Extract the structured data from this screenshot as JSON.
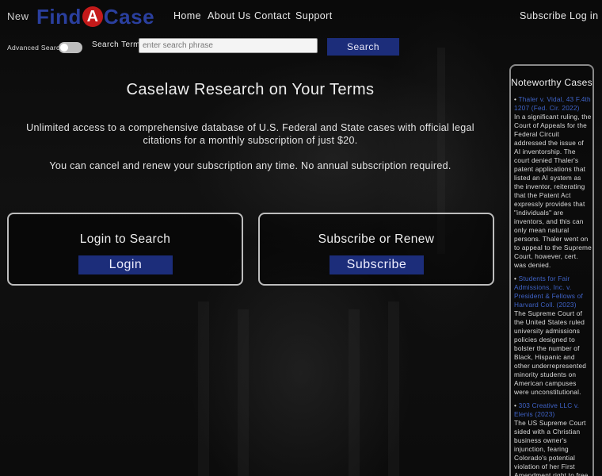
{
  "header": {
    "new_label": "New",
    "logo": {
      "left": "Find",
      "badge": "A",
      "right": "Case"
    },
    "nav": {
      "home": "Home",
      "about": "About Us",
      "contact": "Contact",
      "support": "Support",
      "subscribe": "Subscribe",
      "login": "Log in"
    }
  },
  "search": {
    "advanced_label": "Advanced Search:",
    "term_label": "Search Term:",
    "placeholder": "enter search phrase",
    "button": "Search"
  },
  "hero": {
    "title": "Caselaw Research on Your Terms",
    "text1": "Unlimited access to a comprehensive database of U.S. Federal and State cases with official legal citations for a monthly subscription of just $20.",
    "text2": "You can cancel and renew your subscription any time. No annual subscription required."
  },
  "cards": {
    "login": {
      "title": "Login to Search",
      "button": "Login"
    },
    "subscribe": {
      "title": "Subscribe or Renew",
      "button": "Subscribe"
    }
  },
  "sidebar": {
    "title": "Noteworthy Cases",
    "cases": [
      {
        "link": "Thaler v. Vidal, 43 F.4th 1207 (Fed. Cir. 2022)",
        "text": "In a significant ruling, the Court of Appeals for the Federal Circuit addressed the issue of AI inventorship. The court denied Thaler's patent applications that listed an AI system as the inventor, reiterating that the Patent Act expressly provides that \"individuals\" are inventors, and this can only mean natural persons. Thaler went on to appeal to the Supreme Court, however, cert. was denied."
      },
      {
        "link": "Students for Fair Admissions, Inc. v. President & Fellows of Harvard Coll. (2023)",
        "text": "The Supreme Court of the United States ruled university admissions policies designed to bolster the number of Black, Hispanic and other underrepresented minority students on American campuses were unconstitutional."
      },
      {
        "link": "303 Creative LLC v. Elenis (2023)",
        "text": "The US Supreme Court sided with a Christian business owner's injunction, fearing Colorado's potential violation of her First Amendment right to free"
      }
    ]
  }
}
